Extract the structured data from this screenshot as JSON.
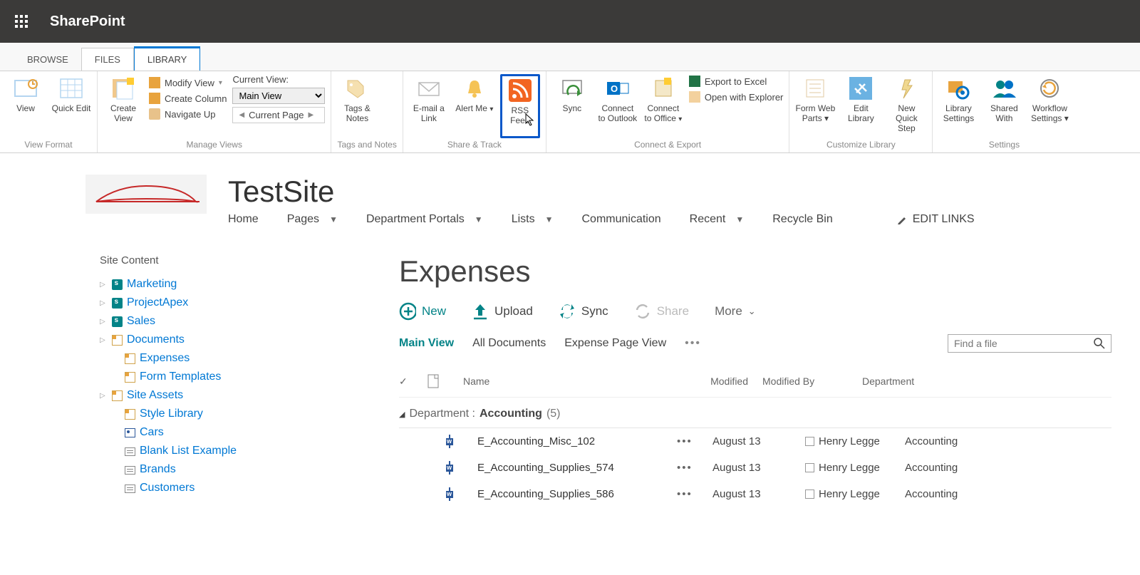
{
  "topbar": {
    "product": "SharePoint"
  },
  "tabs": {
    "browse": "BROWSE",
    "files": "FILES",
    "library": "LIBRARY"
  },
  "ribbon": {
    "view_format": {
      "label": "View Format",
      "view": "View",
      "quick_edit": "Quick Edit"
    },
    "manage_views": {
      "label": "Manage Views",
      "create_view": "Create View",
      "modify_view": "Modify View",
      "create_column": "Create Column",
      "navigate_up": "Navigate Up",
      "current_view_label": "Current View:",
      "current_view_value": "Main View",
      "current_page": "Current Page"
    },
    "tags_notes": {
      "label": "Tags and Notes",
      "btn": "Tags & Notes"
    },
    "share_track": {
      "label": "Share & Track",
      "email": "E-mail a Link",
      "alert": "Alert Me",
      "rss": "RSS Feed"
    },
    "connect_export": {
      "label": "Connect & Export",
      "sync": "Sync",
      "outlook": "Connect to Outlook",
      "office": "Connect to Office",
      "excel": "Export to Excel",
      "explorer": "Open with Explorer"
    },
    "customize": {
      "label": "Customize Library",
      "form": "Form Web Parts",
      "edit": "Edit Library",
      "quick": "New Quick Step"
    },
    "settings": {
      "label": "Settings",
      "lib": "Library Settings",
      "shared": "Shared With",
      "wf": "Workflow Settings"
    }
  },
  "site": {
    "title": "TestSite",
    "nav": [
      {
        "label": "Home",
        "dd": false
      },
      {
        "label": "Pages",
        "dd": true
      },
      {
        "label": "Department Portals",
        "dd": true
      },
      {
        "label": "Lists",
        "dd": true
      },
      {
        "label": "Communication",
        "dd": false
      },
      {
        "label": "Recent",
        "dd": true
      },
      {
        "label": "Recycle Bin",
        "dd": false
      }
    ],
    "edit_links": "EDIT LINKS"
  },
  "quicklaunch": {
    "header": "Site Content",
    "items": [
      {
        "label": "Marketing",
        "icon": "sp",
        "indent": 0,
        "expand": true
      },
      {
        "label": "ProjectApex",
        "icon": "sp",
        "indent": 0,
        "expand": true
      },
      {
        "label": "Sales",
        "icon": "sp",
        "indent": 0,
        "expand": true
      },
      {
        "label": "Documents",
        "icon": "lib",
        "indent": 0,
        "expand": true
      },
      {
        "label": "Expenses",
        "icon": "lib",
        "indent": 1,
        "expand": false
      },
      {
        "label": "Form Templates",
        "icon": "lib",
        "indent": 1,
        "expand": false
      },
      {
        "label": "Site Assets",
        "icon": "lib",
        "indent": 0,
        "expand": true
      },
      {
        "label": "Style Library",
        "icon": "lib",
        "indent": 1,
        "expand": false
      },
      {
        "label": "Cars",
        "icon": "img",
        "indent": 1,
        "expand": false
      },
      {
        "label": "Blank List Example",
        "icon": "list",
        "indent": 1,
        "expand": false
      },
      {
        "label": "Brands",
        "icon": "list",
        "indent": 1,
        "expand": false
      },
      {
        "label": "Customers",
        "icon": "list",
        "indent": 1,
        "expand": false
      }
    ]
  },
  "list": {
    "title": "Expenses",
    "cmds": {
      "new": "New",
      "upload": "Upload",
      "sync": "Sync",
      "share": "Share",
      "more": "More"
    },
    "views": {
      "main": "Main View",
      "all": "All Documents",
      "expense": "Expense Page View"
    },
    "search_placeholder": "Find a file",
    "cols": {
      "name": "Name",
      "modified": "Modified",
      "modified_by": "Modified By",
      "dept": "Department"
    },
    "group": {
      "field": "Department",
      "value": "Accounting",
      "count": "(5)"
    },
    "rows": [
      {
        "name": "E_Accounting_Misc_102",
        "modified": "August 13",
        "modified_by": "Henry Legge",
        "dept": "Accounting"
      },
      {
        "name": "E_Accounting_Supplies_574",
        "modified": "August 13",
        "modified_by": "Henry Legge",
        "dept": "Accounting"
      },
      {
        "name": "E_Accounting_Supplies_586",
        "modified": "August 13",
        "modified_by": "Henry Legge",
        "dept": "Accounting"
      }
    ]
  }
}
